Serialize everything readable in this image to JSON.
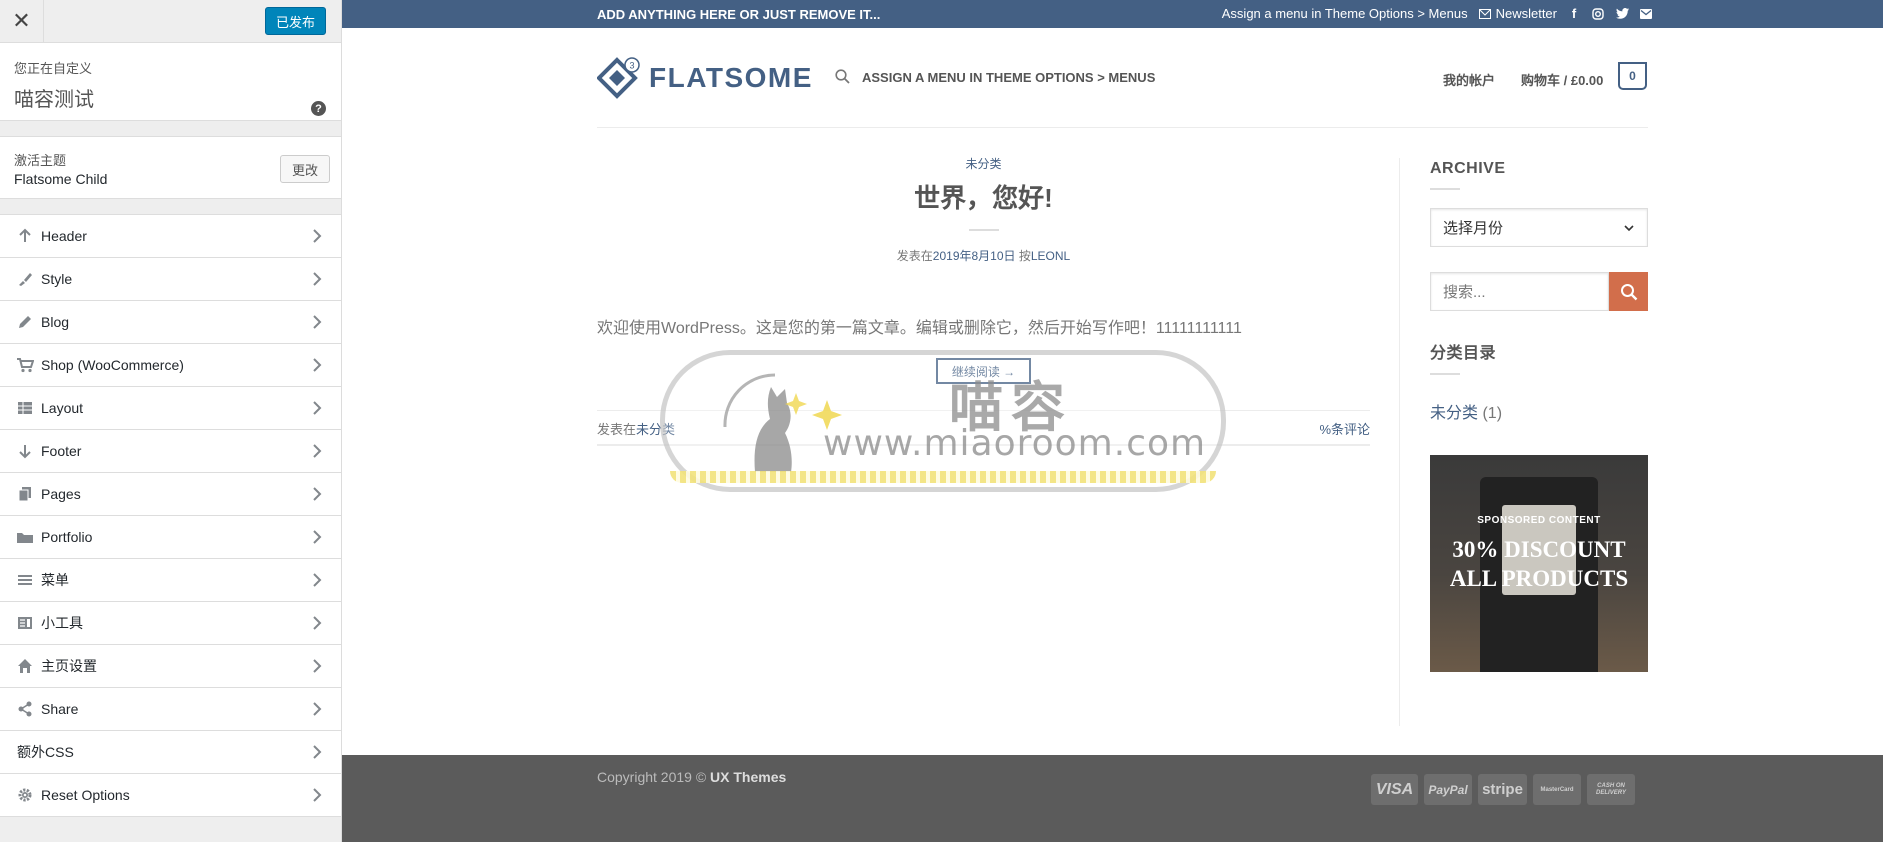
{
  "customizer": {
    "close_icon": "close-icon",
    "publish_label": "已发布",
    "info_label": "您正在自定义",
    "site_title": "喵容测试",
    "help_glyph": "?",
    "theme_label": "激活主题",
    "theme_name": "Flatsome Child",
    "change_label": "更改",
    "panels": [
      {
        "label": "Header",
        "icon": "arrow-up-icon"
      },
      {
        "label": "Style",
        "icon": "brush-icon"
      },
      {
        "label": "Blog",
        "icon": "pencil-icon"
      },
      {
        "label": "Shop (WooCommerce)",
        "icon": "cart-icon"
      },
      {
        "label": "Layout",
        "icon": "table-icon"
      },
      {
        "label": "Footer",
        "icon": "arrow-down-icon"
      },
      {
        "label": "Pages",
        "icon": "pages-icon"
      },
      {
        "label": "Portfolio",
        "icon": "folder-icon"
      },
      {
        "label": "菜单",
        "icon": "menu-icon"
      },
      {
        "label": "小工具",
        "icon": "widgets-icon"
      },
      {
        "label": "主页设置",
        "icon": "home-icon"
      },
      {
        "label": "Share",
        "icon": "share-icon"
      },
      {
        "label": "额外CSS",
        "icon": ""
      },
      {
        "label": "Reset Options",
        "icon": "gear-icon"
      }
    ]
  },
  "preview": {
    "topbar": {
      "left_text": "ADD ANYTHING HERE OR JUST REMOVE IT...",
      "menu_text": "Assign a menu in Theme Options > Menus",
      "newsletter": "Newsletter",
      "color": "#446084"
    },
    "header": {
      "logo_text": "FLATSOME",
      "logo_badge": "3",
      "menu_text": "ASSIGN A MENU IN THEME OPTIONS > MENUS",
      "account": "我的帐户",
      "cart": "购物车 / £0.00",
      "cart_count": "0"
    },
    "post": {
      "category": "未分类",
      "title": "世界，您好!",
      "meta_prefix": "发表在",
      "meta_date": "2019年8月10日",
      "meta_by": " 按",
      "meta_author": "LEONL",
      "excerpt": "欢迎使用WordPress。这是您的第一篇文章。编辑或删除它，然后开始写作吧！11111111111",
      "read_more": "继续阅读 →",
      "footer_prefix": "发表在",
      "footer_cat": "未分类",
      "comments": "%条评论"
    },
    "watermark": {
      "cn": "喵容",
      "url": "www.miaoroom.com"
    },
    "widgets": {
      "archive_title": "ARCHIVE",
      "archive_select": "选择月份",
      "search_placeholder": "搜索...",
      "categories_title": "分类目录",
      "category_link": "未分类",
      "category_count": " (1)",
      "promo_sub": "SPONSORED CONTENT",
      "promo_line1": "30% DISCOUNT",
      "promo_line2": "ALL PRODUCTS"
    },
    "footer": {
      "copyright": "Copyright 2019 © ",
      "copyright_brand": "UX Themes",
      "payments": [
        "VISA",
        "PayPal",
        "stripe",
        "MasterCard",
        "CASH ON DELIVERY"
      ]
    }
  }
}
